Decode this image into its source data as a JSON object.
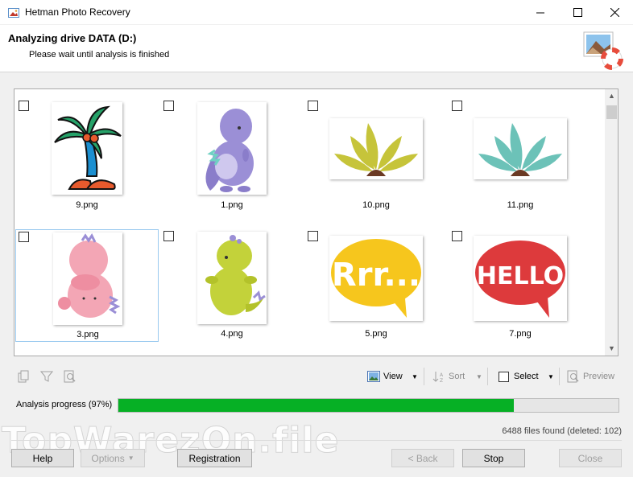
{
  "window": {
    "title": "Hetman Photo Recovery",
    "minimize": "—",
    "maximize": "☐",
    "close": "✕"
  },
  "header": {
    "title": "Analyzing drive DATA (D:)",
    "subtitle": "Please wait until analysis is finished"
  },
  "files": [
    {
      "name": "9.png",
      "icon": "palm-tree-icon"
    },
    {
      "name": "1.png",
      "icon": "purple-dinosaur-icon"
    },
    {
      "name": "10.png",
      "icon": "olive-leaves-icon"
    },
    {
      "name": "11.png",
      "icon": "teal-leaves-icon"
    },
    {
      "name": "3.png",
      "icon": "pink-dinosaur-icon"
    },
    {
      "name": "4.png",
      "icon": "green-dinosaur-icon"
    },
    {
      "name": "5.png",
      "icon": "rrr-speech-bubble-icon",
      "text": "Rrr..."
    },
    {
      "name": "7.png",
      "icon": "hello-speech-bubble-icon",
      "text": "HELLO"
    }
  ],
  "toolbar": {
    "view": "View",
    "sort": "Sort",
    "select": "Select",
    "preview": "Preview"
  },
  "progress": {
    "label": "Analysis progress (97%)",
    "value": 0.79,
    "color": "#06b025"
  },
  "status": {
    "files_found": "6488 files found (deleted: 102)"
  },
  "watermark": "TopWarezOn.file",
  "buttons": {
    "help": "Help",
    "options": "Options",
    "registration": "Registration",
    "back": "< Back",
    "stop": "Stop",
    "close": "Close"
  }
}
